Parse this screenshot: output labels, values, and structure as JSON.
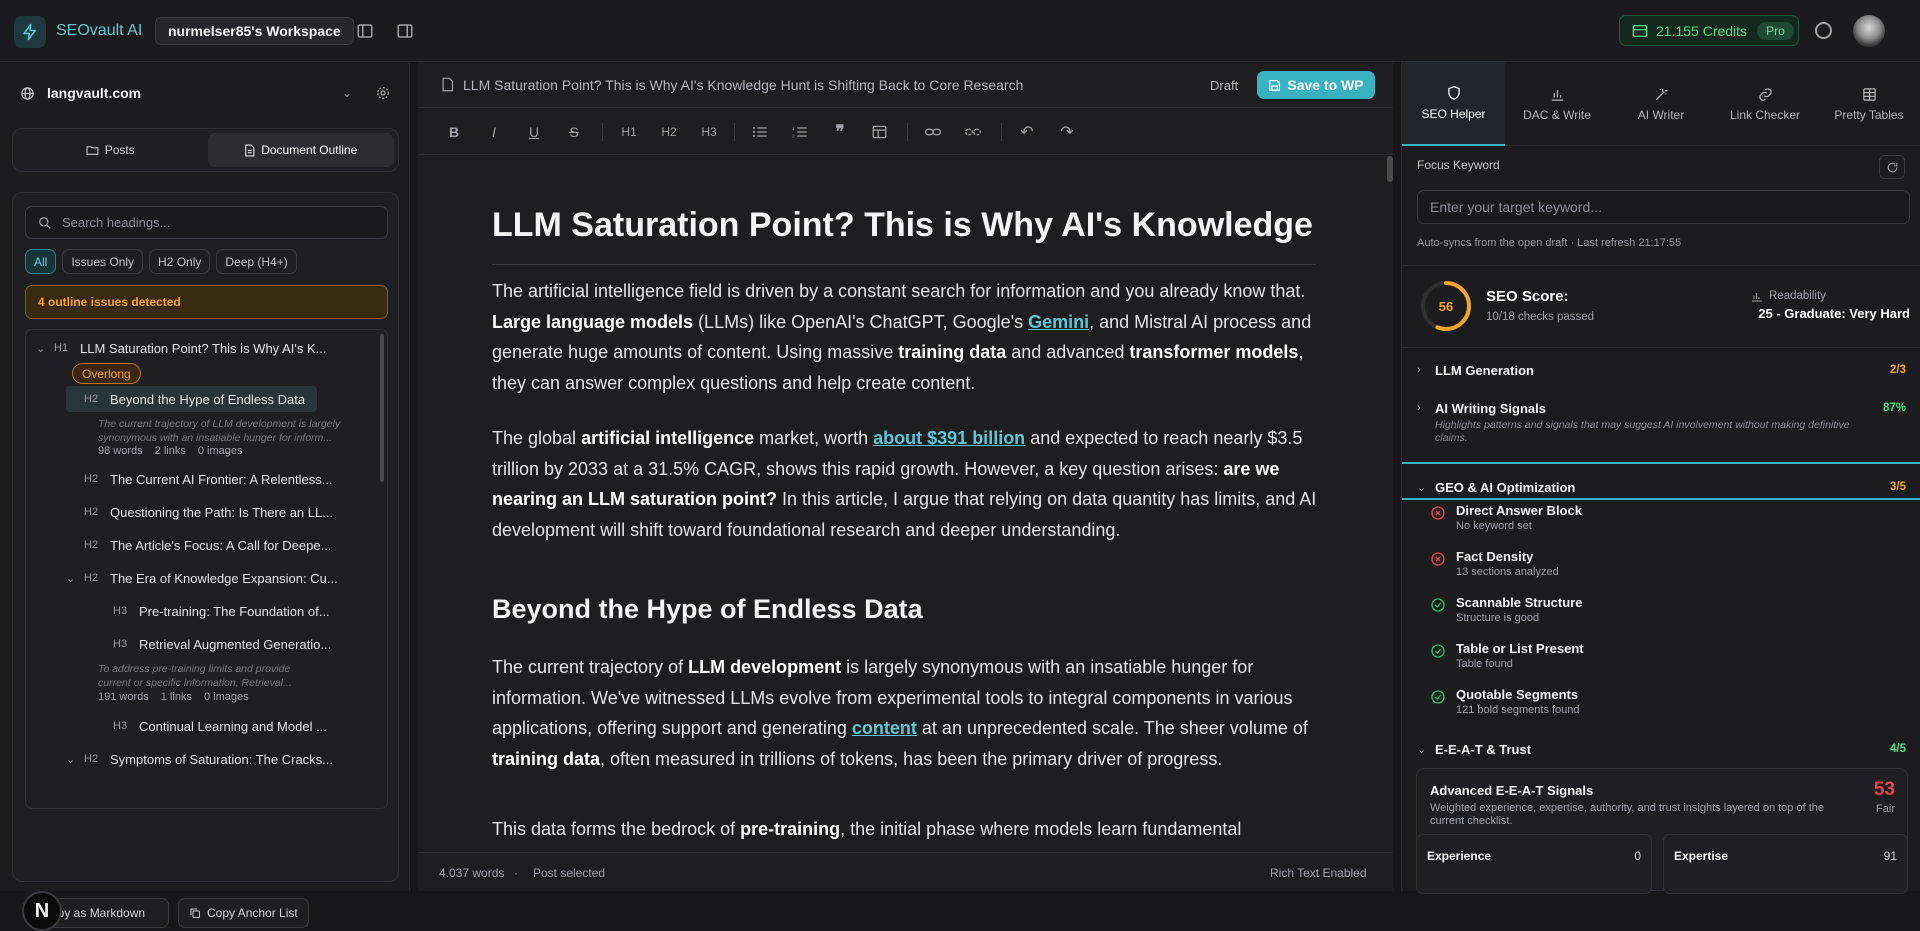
{
  "topbar": {
    "brand": "SEOvault AI",
    "workspace": "nurmelser85's Workspace",
    "credits": "21.155 Credits",
    "plan": "Pro",
    "colors": {
      "accent": "#38b2c2",
      "credits": "#4ade80"
    }
  },
  "left": {
    "site": "langvault.com",
    "tabs": [
      "Posts",
      "Document Outline"
    ],
    "active_tab": "Document Outline",
    "search_placeholder": "Search headings...",
    "filters": [
      "All",
      "Issues Only",
      "H2 Only",
      "Deep (H4+)"
    ],
    "active_filter": "All",
    "issues_banner": "4 outline issues detected",
    "outline": [
      {
        "level": "H1",
        "text": "LLM Saturation Point? This is Why AI's K...",
        "badge": "Overlong"
      },
      {
        "level": "H2",
        "text": "Beyond the Hype of Endless Data",
        "selected": true,
        "snippet": "The current trajectory of LLM development is largely synonymous with an insatiable hunger for inform...",
        "meta": [
          "98 words",
          "2 links",
          "0 images"
        ]
      },
      {
        "level": "H2",
        "text": "The Current AI Frontier: A Relentless..."
      },
      {
        "level": "H2",
        "text": "Questioning the Path: Is There an LL..."
      },
      {
        "level": "H2",
        "text": "The Article's Focus: A Call for Deepe..."
      },
      {
        "level": "H2",
        "text": "The Era of Knowledge Expansion: Cu..."
      },
      {
        "level": "H3",
        "text": "Pre-training: The Foundation of..."
      },
      {
        "level": "H3",
        "text": "Retrieval Augmented Generatio...",
        "snippet": "To address pre-training limits and provide current or specific information, Retrieval...",
        "meta": [
          "191 words",
          "1 links",
          "0 images"
        ]
      },
      {
        "level": "H3",
        "text": "Continual Learning and Model ..."
      },
      {
        "level": "H2",
        "text": "Symptoms of Saturation: The Cracks..."
      }
    ],
    "footer_buttons": [
      "Copy as Markdown",
      "Copy Anchor List"
    ],
    "footer_button_visible": "opy as Markdown",
    "avatar_letter": "N"
  },
  "doc": {
    "title": "LLM Saturation Point? This is Why AI's Knowledge Hunt is Shifting Back to Core Research",
    "status": "Draft",
    "save_label": "Save to WP",
    "toolbar": {
      "h1": "H1",
      "h2": "H2",
      "h3": "H3"
    },
    "h1": "LLM Saturation Point? This is Why AI's Knowledge",
    "p1": {
      "a": "The artificial intelligence field is driven by a constant search for information and you already know that. ",
      "b1": "Large language models",
      "c": " (LLMs) like OpenAI's ChatGPT, Google's ",
      "link": "Gemini",
      "d": ", and Mistral AI process and generate huge amounts of content. Using massive ",
      "b2": "training data",
      "e": " and advanced ",
      "b3": "transformer models",
      "f": ", they can answer complex questions and help create content."
    },
    "p2": {
      "a": "The global ",
      "b1": "artificial intelligence",
      "c": " market, worth ",
      "link": "about $391 billion",
      "d": " and expected to reach nearly $3.5 trillion by 2033 at a 31.5% CAGR, shows this rapid growth. However, a key question arises: ",
      "b2": "are we nearing an LLM saturation point?",
      "e": " In this article, I argue that relying on data quantity has limits, and AI development will shift toward foundational research and deeper understanding."
    },
    "h2": "Beyond the Hype of Endless Data",
    "p3": {
      "a": "The current trajectory of ",
      "b1": "LLM development",
      "c": " is largely synonymous with an insatiable hunger for information. We've witnessed LLMs evolve from experimental tools to integral components in various applications, offering support and generating ",
      "link": "content",
      "d": " at an unprecedented scale. The sheer volume of ",
      "b2": "training data",
      "e": ", often measured in trillions of tokens, has been the primary driver of progress."
    },
    "p4": {
      "a": "This data forms the bedrock of ",
      "b1": "pre-training",
      "c": ", the initial phase where models learn fundamental"
    },
    "status_words": "4.037 words",
    "status_sep": "·",
    "status_selected": "Post selected",
    "status_mode": "Rich Text Enabled"
  },
  "right": {
    "tabs": [
      "SEO Helper",
      "DAC & Write",
      "AI Writer",
      "Link Checker",
      "Pretty Tables"
    ],
    "active_tab": "SEO Helper",
    "focus_label": "Focus Keyword",
    "focus_placeholder": "Enter your target keyword...",
    "autosync": "Auto-syncs from the open draft · Last refresh 21:17:55",
    "score": {
      "value": 56,
      "max": 100,
      "title": "SEO Score:",
      "sub": "10/18 checks passed"
    },
    "readability": {
      "label": "Readability",
      "value": "25 - Graduate: Very Hard"
    },
    "sections": [
      {
        "title": "LLM Generation",
        "value": "2/3",
        "color": "#f5a524"
      },
      {
        "title": "AI Writing Signals",
        "value": "87%",
        "color": "#4ade80",
        "desc": "Highlights patterns and signals that may suggest AI involvement without making definitive claims."
      },
      {
        "title": "GEO & AI Optimization",
        "value": "3/5",
        "color": "#f5a524"
      },
      {
        "title": "E-E-A-T & Trust",
        "value": "4/5",
        "color": "#4ade80"
      }
    ],
    "checks": [
      {
        "title": "Direct Answer Block",
        "sub": "No keyword set",
        "status": "fail"
      },
      {
        "title": "Fact Density",
        "sub": "13 sections analyzed",
        "status": "fail"
      },
      {
        "title": "Scannable Structure",
        "sub": "Structure is good",
        "status": "pass"
      },
      {
        "title": "Table or List Present",
        "sub": "Table found",
        "status": "pass"
      },
      {
        "title": "Quotable Segments",
        "sub": "121 bold segments found",
        "status": "pass"
      }
    ],
    "eeat": {
      "title": "Advanced E-E-A-T Signals",
      "desc": "Weighted experience, expertise, authority, and trust insights layered on top of the current checklist.",
      "score": "53",
      "grade": "Fair",
      "metrics": [
        {
          "name": "Experience",
          "value": "0"
        },
        {
          "name": "Expertise",
          "value": "91"
        }
      ]
    }
  }
}
